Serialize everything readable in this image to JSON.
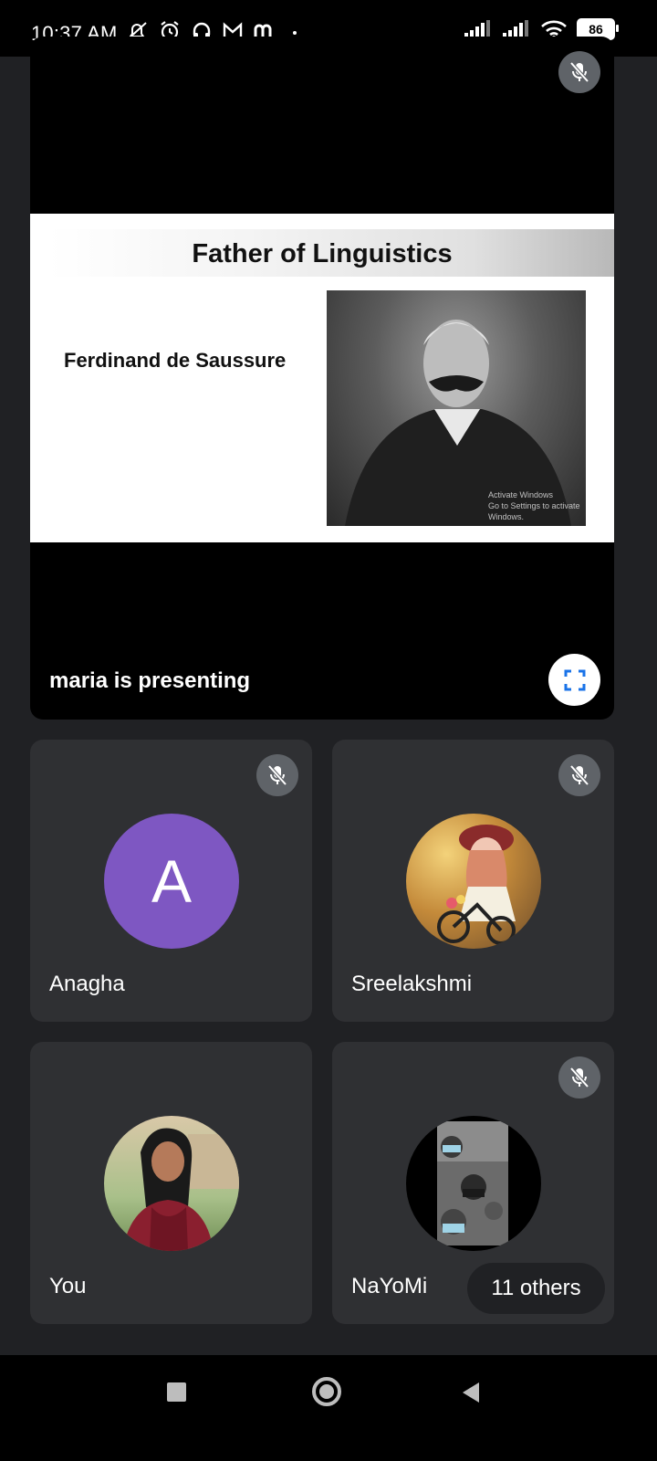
{
  "status_bar": {
    "time": "10:37 AM",
    "battery": "86",
    "icons": [
      "mute-icon",
      "alarm-icon",
      "headset-icon",
      "gmail-icon",
      "m-app-icon",
      "dot-icon",
      "signal-icon",
      "signal-icon",
      "wifi-icon",
      "battery-icon"
    ]
  },
  "presentation": {
    "slide_title": "Father of Linguistics",
    "slide_subtitle": "Ferdinand de Saussure",
    "watermark_line1": "Activate Windows",
    "watermark_line2": "Go to Settings to activate Windows.",
    "presenter_label": "maria is presenting",
    "mic_state": "muted"
  },
  "participants": [
    {
      "name": "Anagha",
      "avatar_letter": "A",
      "avatar_color": "#7e57c2",
      "muted": true
    },
    {
      "name": "Sreelakshmi",
      "muted": true
    },
    {
      "name": "You",
      "muted": false
    },
    {
      "name": "NaYoMi",
      "muted": true
    }
  ],
  "others_label": "11 others",
  "colors": {
    "background": "#202124",
    "tile": "#2f3033",
    "mic_off_badge": "#5f6368",
    "expand_icon": "#1a73e8"
  }
}
